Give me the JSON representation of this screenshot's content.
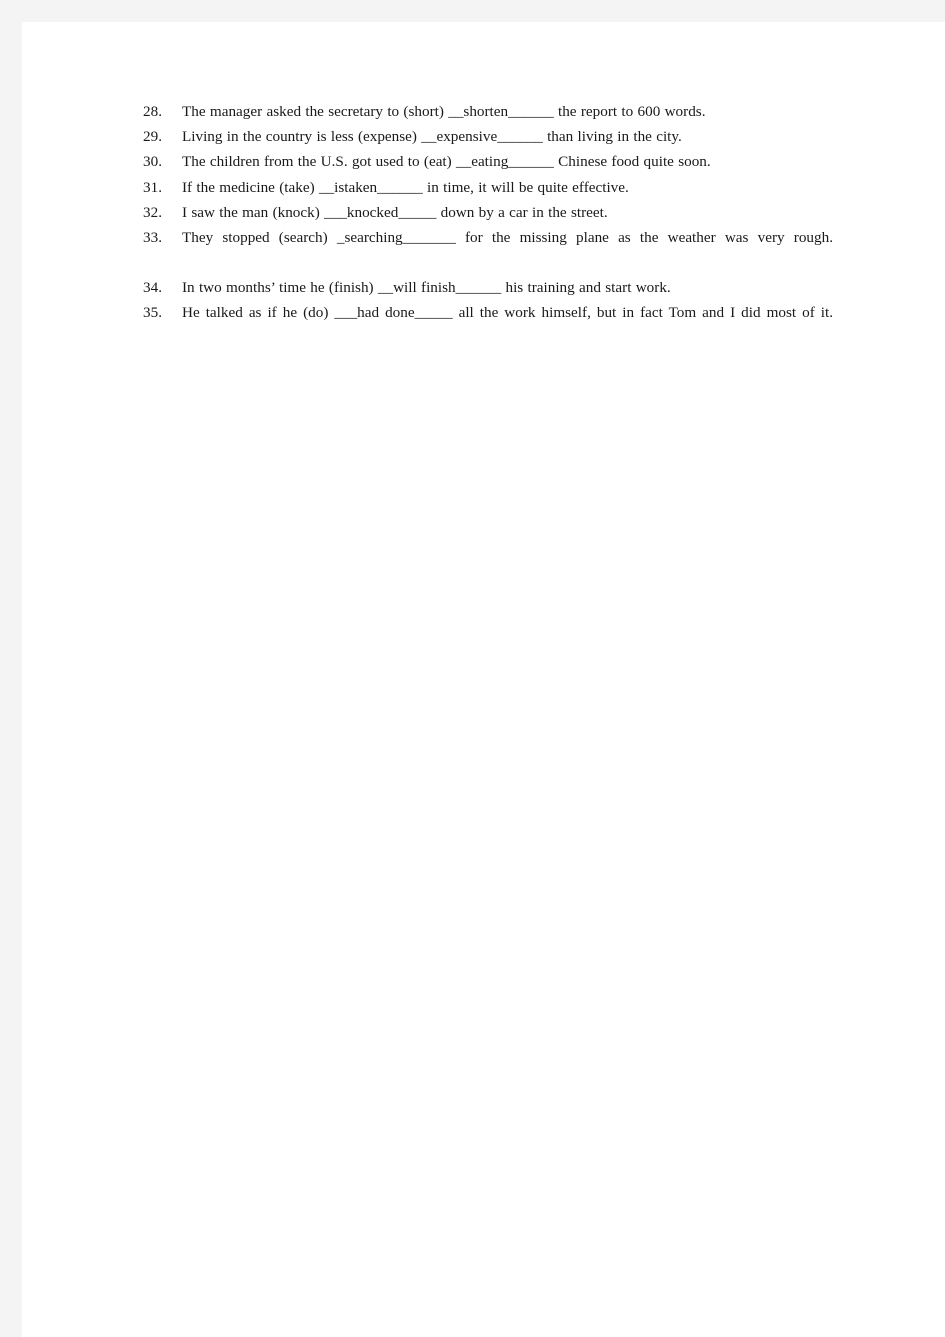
{
  "page": {
    "background_color": "#f4f4f5",
    "sheet_color": "#ffffff",
    "text_color": "#1a1a1a"
  },
  "exercises": [
    {
      "number": "28.",
      "before": "The manager asked the secretary to (short)",
      "blank": "__shorten______",
      "after": "the report to 600 words.",
      "multiline": false
    },
    {
      "number": "29.",
      "before": "Living in the country is less (expense)",
      "blank": "__expensive______",
      "after": "than living in the city.",
      "multiline": false
    },
    {
      "number": "30.",
      "before": "The children from the U.S. got used to (eat)",
      "blank": "__eating______",
      "after": "Chinese food quite soon.",
      "multiline": false
    },
    {
      "number": "31.",
      "before": "If the medicine (take)",
      "blank": "__istaken______",
      "after": "in time, it will be quite effective.",
      "multiline": false
    },
    {
      "number": "32.",
      "before": "I saw the man (knock)",
      "blank": "___knocked_____",
      "after": "down by a car in the street.",
      "multiline": false
    },
    {
      "number": "33.",
      "before": "They stopped (search)",
      "blank": "_searching_______",
      "after": "for the missing plane as the weather was very rough.",
      "multiline": true
    },
    {
      "number": "34.",
      "before": "In two months’ time he (finish)",
      "blank": "__will finish______",
      "after": "his training and start work.",
      "multiline": false
    },
    {
      "number": "35.",
      "before": "He talked as if he (do)",
      "blank": "___had done_____",
      "after": "all the work himself, but in fact Tom and I did most of it.",
      "multiline": true
    }
  ]
}
